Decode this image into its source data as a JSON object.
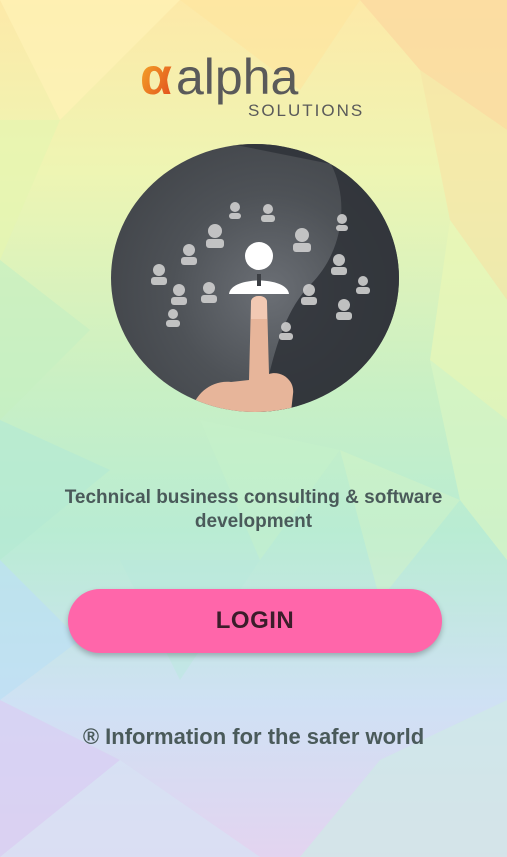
{
  "brand": {
    "name": "alpha",
    "sub": "SOLUTIONS"
  },
  "hero": {
    "image_label": "person touching network of user icons"
  },
  "tagline": "Technical business consulting & software development",
  "login_button": "LOGIN",
  "footer": "® Information for the safer world",
  "colors": {
    "login": "#ff66aa",
    "text": "#4a5a5a",
    "logo_gray": "#5a5a5a",
    "logo_orange": "#f08a1c"
  }
}
